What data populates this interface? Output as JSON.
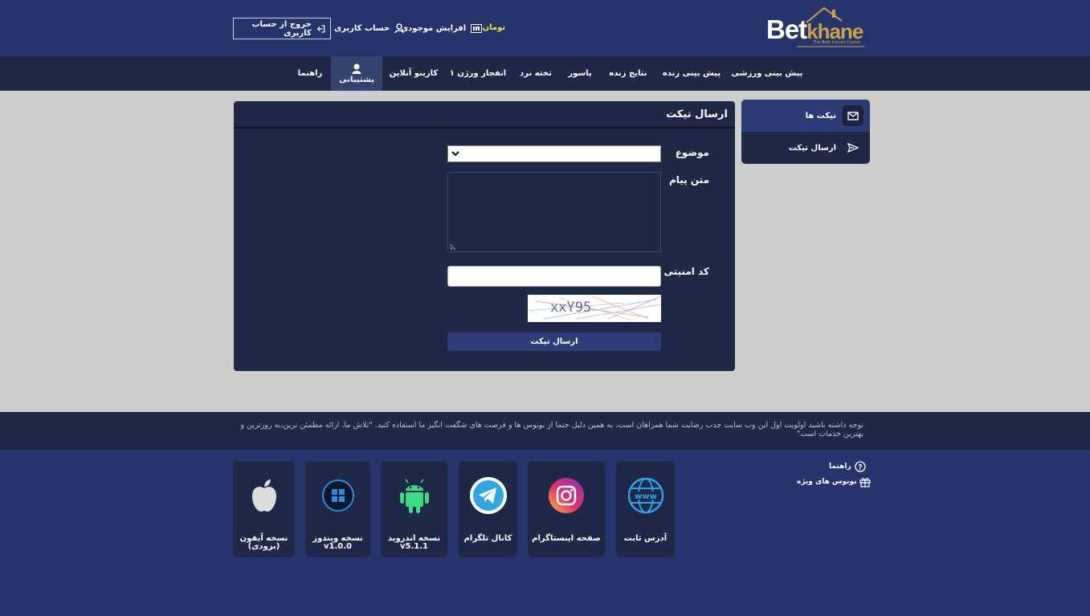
{
  "header": {
    "logo_main": "Bet",
    "logo_sub": "khane",
    "logo_tagline": "The Best Iranian Casino",
    "logout_label": "خروج از حساب کاربری",
    "account_label": "حساب کاربری",
    "deposit_label": "افزایش موجودی",
    "balance": "تومان ۰"
  },
  "nav": {
    "items": [
      {
        "label": "پیش بینی ورزشی"
      },
      {
        "label": "پیش بینی زنده"
      },
      {
        "label": "نتایج زنده"
      },
      {
        "label": "پاسور"
      },
      {
        "label": "تخته نرد"
      },
      {
        "label": "انفجار ورژن ۱"
      },
      {
        "label": "کازینو آنلاین"
      },
      {
        "label": "پشتیبانی"
      },
      {
        "label": "راهنما"
      }
    ]
  },
  "sidebar": {
    "items": [
      {
        "label": "تیکت ها"
      },
      {
        "label": "ارسال تیکت"
      }
    ]
  },
  "form": {
    "title": "ارسال تیکت",
    "subject_label": "موضوع",
    "subject_value": "",
    "message_label": "متن پیام",
    "captcha_label": "کد امنیتی",
    "captcha_text": "xxY95",
    "submit_label": "ارسال تیکت"
  },
  "notice": {
    "text": "توجه داشته باشید اولویت اول این وب سایت جذب رضایت شما همراهان است، به همین دلیل حتما از بونوس ها و فرصت های شگفت انگیز ما استفاده کنید. \"تلاش ما، ارائه مطمئن ترین،به روزترین و بهترین خدمات است\""
  },
  "footer": {
    "links": [
      {
        "label": "راهنما"
      },
      {
        "label": "بونوس های ویژه"
      }
    ],
    "apps": [
      {
        "label": "آدرس ثابت"
      },
      {
        "label": "صفحه اینستاگرام"
      },
      {
        "label": "کانال تلگرام"
      },
      {
        "label": "نسخه اندروید",
        "version": "v5.1.1"
      },
      {
        "label": "نسخه ویندوز",
        "version": "v1.0.0"
      },
      {
        "label": "نسخه آیفون",
        "version": "(بزودی)"
      }
    ]
  },
  "colors": {
    "header_bg": "#25356b",
    "nav_bg": "#1f2846",
    "content_bg": "#cdcdcd",
    "panel_bg": "#1f2846",
    "accent_gold": "#c9a24a",
    "balance_yellow": "#f2e84a"
  }
}
